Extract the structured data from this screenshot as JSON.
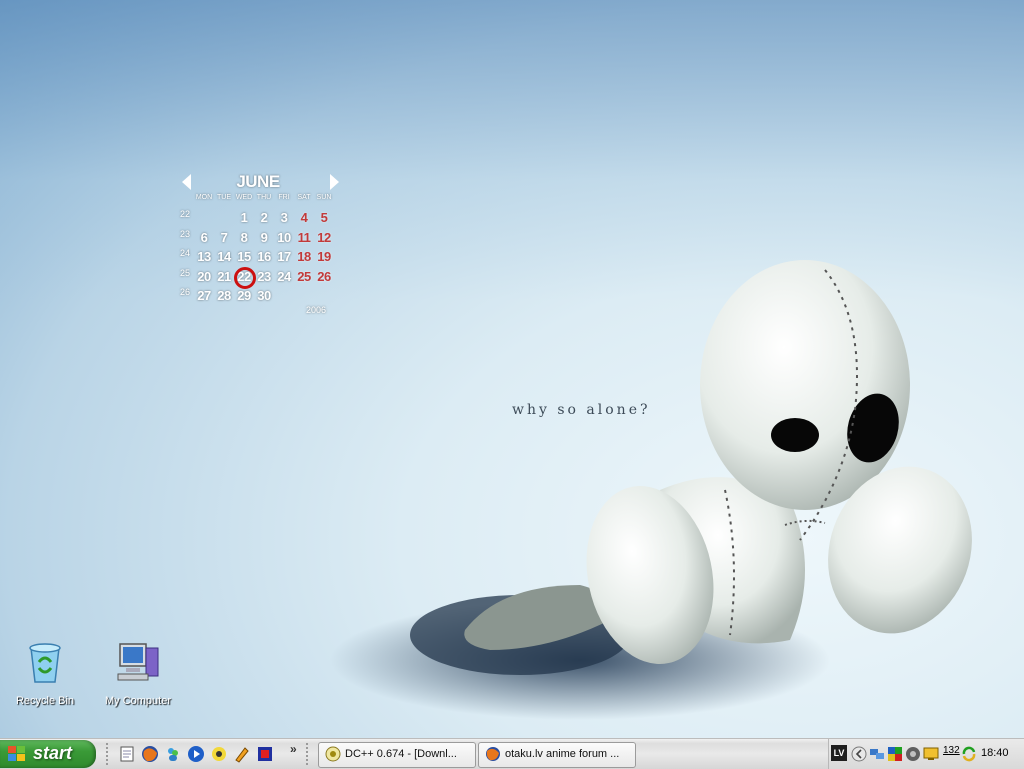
{
  "calendar": {
    "month": "JUNE",
    "year": "2006",
    "weekdays": [
      "MON",
      "TUE",
      "WED",
      "THU",
      "FRI",
      "SAT",
      "SUN"
    ],
    "weeks": [
      {
        "week": "22",
        "days": [
          "",
          "",
          "1",
          "2",
          "3",
          "4",
          "5"
        ]
      },
      {
        "week": "23",
        "days": [
          "6",
          "7",
          "8",
          "9",
          "10",
          "11",
          "12"
        ]
      },
      {
        "week": "24",
        "days": [
          "13",
          "14",
          "15",
          "16",
          "17",
          "18",
          "19"
        ]
      },
      {
        "week": "25",
        "days": [
          "20",
          "21",
          "22",
          "23",
          "24",
          "25",
          "26"
        ]
      },
      {
        "week": "26",
        "days": [
          "27",
          "28",
          "29",
          "30",
          "",
          "",
          ""
        ]
      }
    ],
    "today": "22",
    "colors": {
      "weekend": "#c23a3a",
      "today_ring": "#cc1010"
    }
  },
  "wallpaper": {
    "tagline": "why so alone?"
  },
  "desktop_icons": [
    {
      "label": "Recycle Bin",
      "icon": "recycle-bin-icon"
    },
    {
      "label": "My Computer",
      "icon": "my-computer-icon"
    }
  ],
  "taskbar": {
    "start_label": "start",
    "quick_launch": [
      "notepad-icon",
      "firefox-icon",
      "msn-icon",
      "media-player-icon",
      "winamp-icon",
      "pencil-icon",
      "app-icon"
    ],
    "overflow_label": "»",
    "tasks": [
      {
        "label": "DC++ 0.674 - [Downl...",
        "icon": "dcpp-icon"
      },
      {
        "label": "otaku.lv anime forum ...",
        "icon": "firefox-icon"
      }
    ],
    "tray": {
      "language": "LV",
      "counter": "132",
      "clock": "18:40"
    }
  }
}
